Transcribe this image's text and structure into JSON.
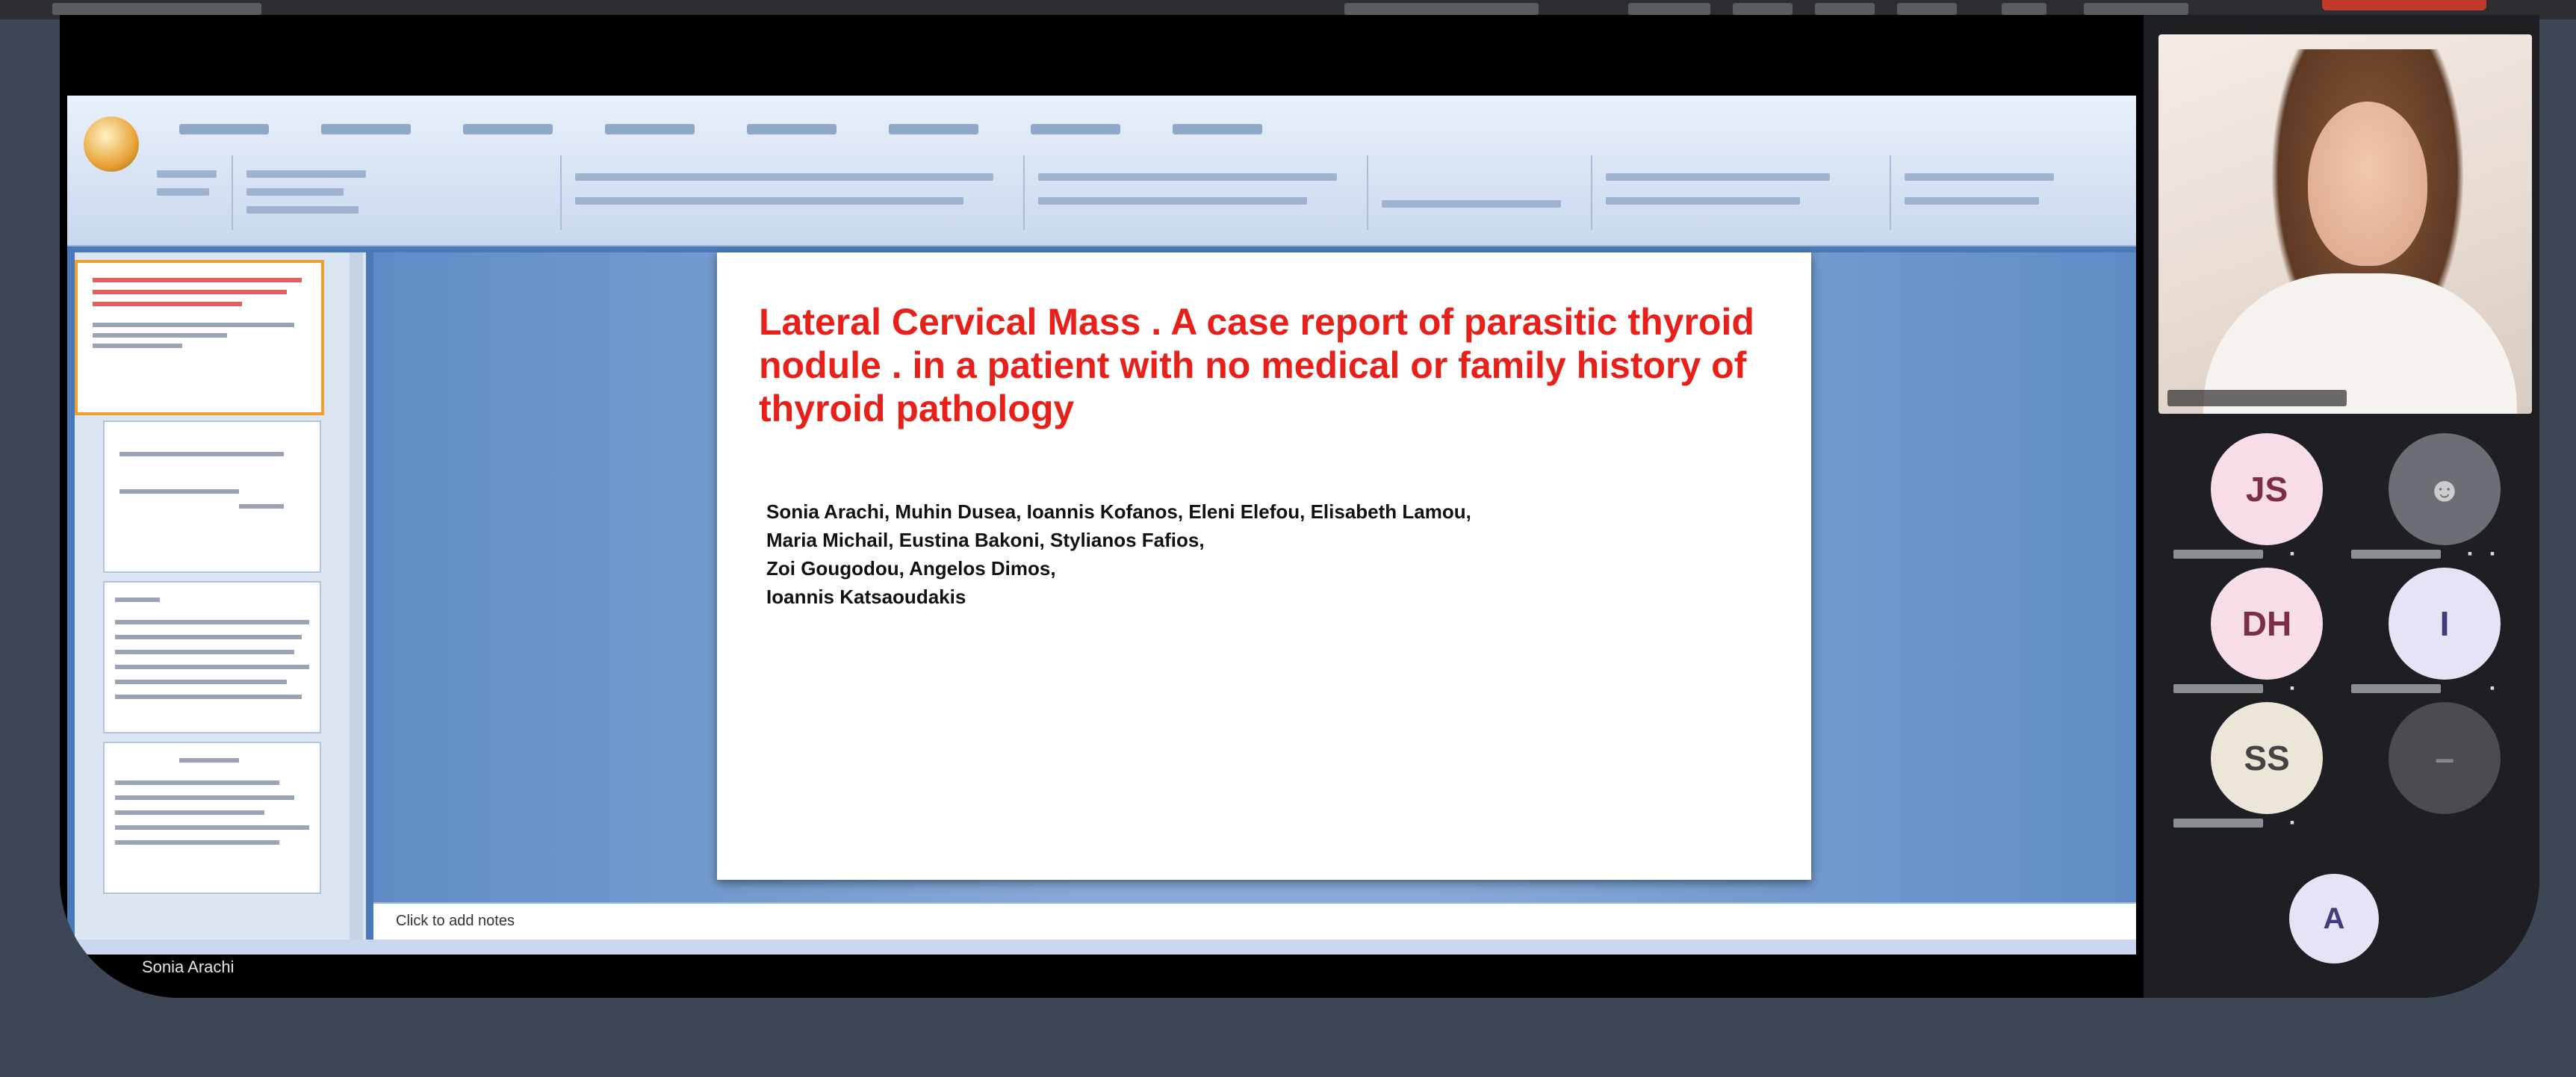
{
  "slide": {
    "title": "Lateral Cervical Mass . A case report of parasitic thyroid nodule . in a patient with no medical or family history of thyroid pathology",
    "authors": [
      "Sonia Arachi, Muhin Dusea, Ioannis Kofanos, Eleni Elefou, Elisabeth Lamou,",
      "Maria Michail, Eustina Bakoni, Stylianos Fafios,",
      "Zoi Gougodou, Angelos Dimos,",
      "Ioannis Katsaoudakis"
    ]
  },
  "notes": {
    "placeholder": "Click to add notes"
  },
  "presenter": {
    "name": "Sonia Arachi"
  },
  "participants": [
    {
      "initials": "JS",
      "style": "pink"
    },
    {
      "initials": "",
      "style": "grey"
    },
    {
      "initials": "DH",
      "style": "pink"
    },
    {
      "initials": "I",
      "style": "lav"
    },
    {
      "initials": "SS",
      "style": "cream"
    },
    {
      "initials": "",
      "style": "dark"
    }
  ],
  "self": {
    "initials": "A"
  },
  "icons": {
    "mic": "mic-icon",
    "person": "person-icon",
    "office": "office-button-icon"
  },
  "colors": {
    "slide_title": "#e8201a",
    "background": "#3d4654",
    "ribbon": "#c9d8ee"
  }
}
